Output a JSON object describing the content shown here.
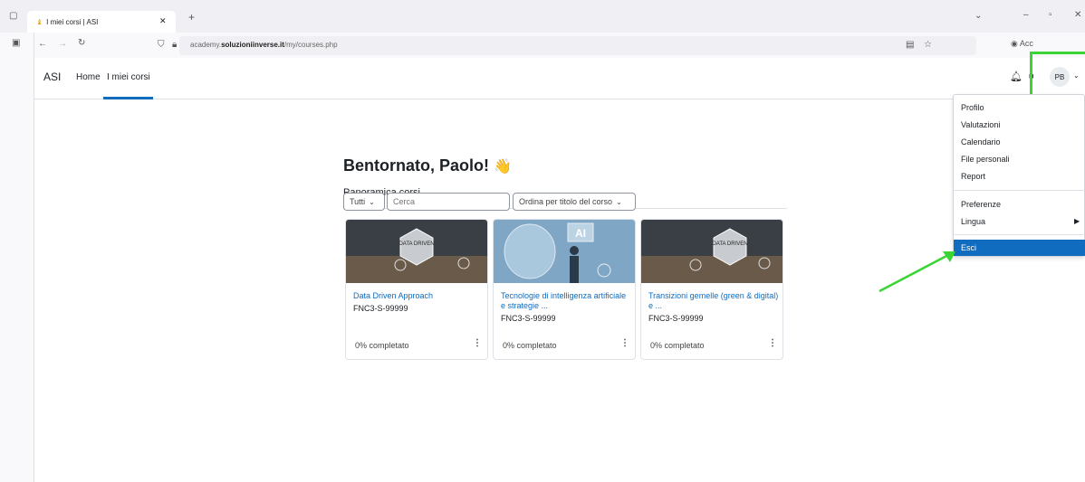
{
  "browser": {
    "tab_title": "I miei corsi | ASI",
    "url_prefix": "academy.",
    "url_domain": "soluzioniinverse.it",
    "url_path": "/my/courses.php",
    "account_label": "Acc"
  },
  "navbar": {
    "brand": "ASI",
    "links": [
      "Home",
      "I miei corsi"
    ],
    "avatar_initials": "PB"
  },
  "main": {
    "welcome": "Bentornato, Paolo!",
    "wave_emoji": "👋",
    "subtitle": "Panoramica corsi",
    "filter_label": "Tutti",
    "search_placeholder": "Cerca",
    "sort_label": "Ordina per titolo del corso"
  },
  "courses": [
    {
      "title": "Data Driven Approach",
      "code": "FNC3-S-99999",
      "progress": "0% completato",
      "image_text": "DATA DRIVEN"
    },
    {
      "title": "Tecnologie di intelligenza artificiale e strategie ...",
      "code": "FNC3-S-99999",
      "progress": "0% completato",
      "image_text": "AI"
    },
    {
      "title": "Transizioni gemelle (green & digital) e ...",
      "code": "FNC3-S-99999",
      "progress": "0% completato",
      "image_text": "DATA DRIVEN"
    }
  ],
  "user_menu": {
    "group1": [
      "Profilo",
      "Valutazioni",
      "Calendario",
      "File personali",
      "Report"
    ],
    "group2": [
      "Preferenze",
      "Lingua"
    ],
    "group3": [
      "Esci"
    ]
  },
  "colors": {
    "accent": "#0f6cbf",
    "annotation": "#3ad535"
  }
}
